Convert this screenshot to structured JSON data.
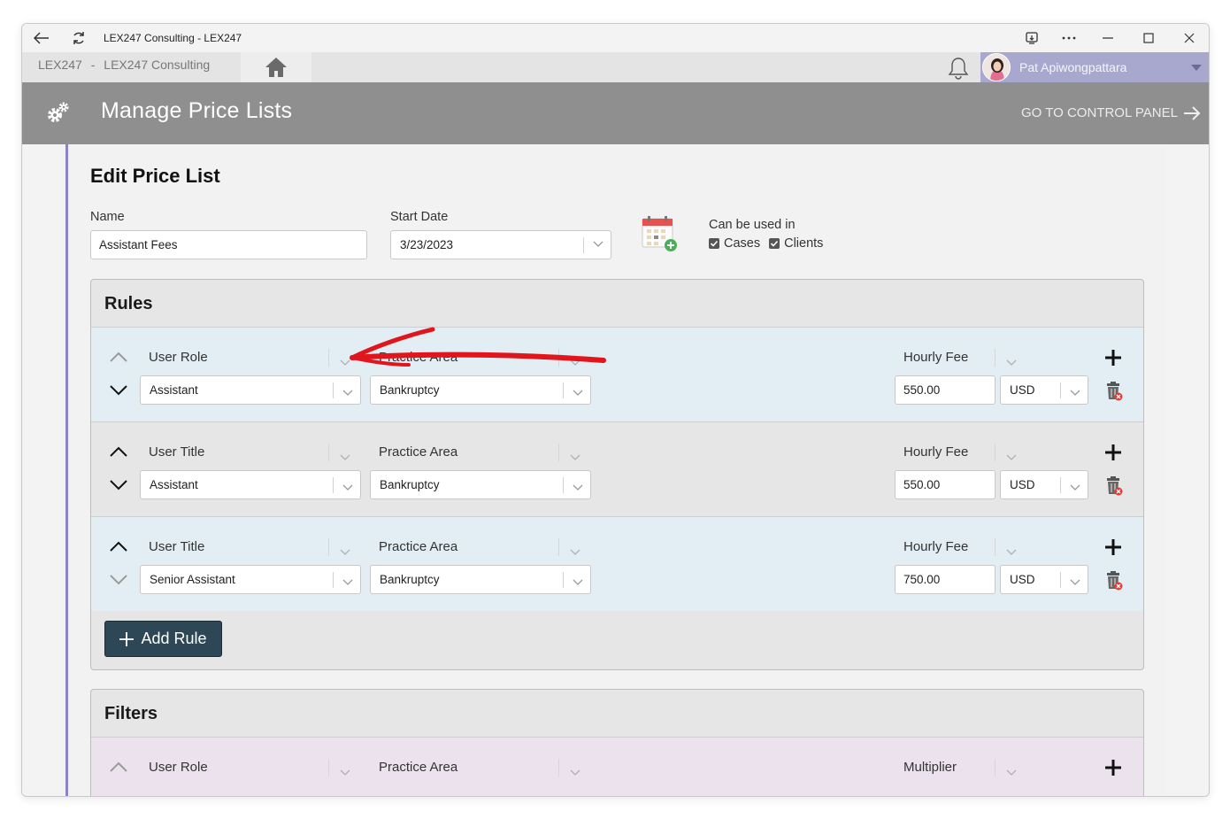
{
  "window": {
    "title": "LEX247 Consulting - LEX247"
  },
  "nav": {
    "crumb_app": "LEX247",
    "crumb_sep": "-",
    "crumb_org": "LEX247 Consulting",
    "user_name": "Pat Apiwongpattara"
  },
  "header": {
    "title": "Manage Price Lists",
    "go_control_panel": "GO TO CONTROL PANEL"
  },
  "form": {
    "title": "Edit Price List",
    "name_label": "Name",
    "name_value": "Assistant Fees",
    "start_date_label": "Start Date",
    "start_date_value": "3/23/2023",
    "usage_label": "Can be used in",
    "usage_options": [
      {
        "label": "Cases",
        "checked": true
      },
      {
        "label": "Clients",
        "checked": true
      }
    ]
  },
  "rules": {
    "title": "Rules",
    "rows": [
      {
        "attr_caption": "User Role",
        "attr_value": "Assistant",
        "area_caption": "Practice Area",
        "area_value": "Bankruptcy",
        "fee_caption": "Hourly Fee",
        "fee_value": "550.00",
        "currency": "USD"
      },
      {
        "attr_caption": "User Title",
        "attr_value": "Assistant",
        "area_caption": "Practice Area",
        "area_value": "Bankruptcy",
        "fee_caption": "Hourly Fee",
        "fee_value": "550.00",
        "currency": "USD"
      },
      {
        "attr_caption": "User Title",
        "attr_value": "Senior Assistant",
        "area_caption": "Practice Area",
        "area_value": "Bankruptcy",
        "fee_caption": "Hourly Fee",
        "fee_value": "750.00",
        "currency": "USD"
      }
    ],
    "add_rule_label": "Add Rule"
  },
  "filters": {
    "title": "Filters",
    "rows": [
      {
        "attr_caption": "User Role",
        "area_caption": "Practice Area",
        "fee_caption": "Multiplier"
      }
    ]
  },
  "colors": {
    "header_bg": "#8f8f8f",
    "user_area_bg": "#a8a8cf",
    "accent_border": "#8c84c6",
    "rule_row_bg": "#e2eef3",
    "filter_row_bg": "#ece2ee",
    "add_rule_bg": "#2e4756",
    "annotation_arrow": "#e0161c"
  }
}
